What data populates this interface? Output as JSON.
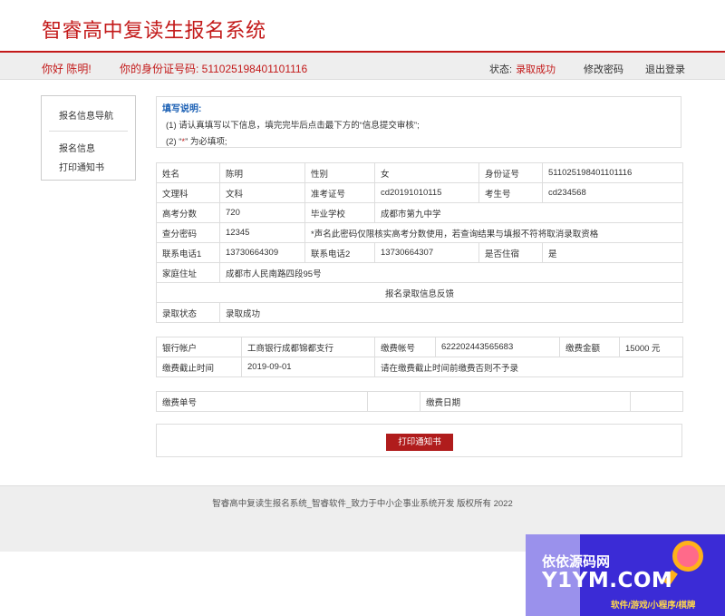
{
  "header": {
    "title": "智睿高中复读生报名系统"
  },
  "userbar": {
    "greeting": "你好 陈明!",
    "id_line": "你的身份证号码:  511025198401101116",
    "status_label": "状态:",
    "status_value": "录取成功",
    "change_password": "修改密码",
    "logout": "退出登录"
  },
  "sidebar": {
    "heading": "报名信息导航",
    "items": [
      "报名信息",
      "打印通知书"
    ]
  },
  "notice": {
    "title": "填写说明:",
    "line1": "(1)  请认真填写以下信息，填完完毕后点击最下方的“信息提交审核”;",
    "line2_pre": "(2)  “",
    "line2_star": "*",
    "line2_post": "” 为必填项;"
  },
  "info": {
    "name_label": "姓名",
    "name": "陈明",
    "gender_label": "性别",
    "gender": "女",
    "idcard_label": "身份证号",
    "idcard": "511025198401101116",
    "track_label": "文理科",
    "track": "文科",
    "admit_label": "准考证号",
    "admit": "cd20191010115",
    "examno_label": "考生号",
    "examno": "cd234568",
    "score_label": "高考分数",
    "score": "720",
    "school_label": "毕业学校",
    "school": "成都市第九中学",
    "query_pw_label": "查分密码",
    "query_pw": "12345",
    "query_pw_note": "*声名此密码仅限核实高考分数使用，若查询结果与填报不符将取消录取资格",
    "phone1_label": "联系电话1",
    "phone1": "13730664309",
    "phone2_label": "联系电话2",
    "phone2": "13730664307",
    "boarding_label": "是否住宿",
    "boarding": "是",
    "address_label": "家庭住址",
    "address": "成都市人民南路四段95号",
    "feedback_header": "报名录取信息反馈",
    "admission_label": "录取状态",
    "admission": "录取成功"
  },
  "fee": {
    "bank_label": "银行帐户",
    "bank": "工商银行成都锦都支行",
    "account_label": "缴费帐号",
    "account": "622202443565683",
    "amount_label": "缴费金额",
    "amount": "15000 元",
    "deadline_label": "缴费截止时间",
    "deadline": "2019-09-01",
    "deadline_note": "请在缴费截止时间前缴费否则不予录"
  },
  "bill": {
    "bill_no_label": "缴费单号",
    "bill_no": "",
    "bill_date_label": "缴费日期",
    "bill_date": ""
  },
  "print_button": "打印通知书",
  "footer": {
    "text": "智睿高中复读生报名系统_智睿软件_致力于中小企事业系统开发  版权所有    2022"
  },
  "watermark": {
    "top": "依依源码网",
    "main": "Y1YM.COM",
    "sub": "软件/游戏/小程序/棋牌"
  },
  "colors": {
    "accent": "#c31a1a",
    "notice_title": "#1a5fb4",
    "button_bg": "#b01c1c"
  }
}
